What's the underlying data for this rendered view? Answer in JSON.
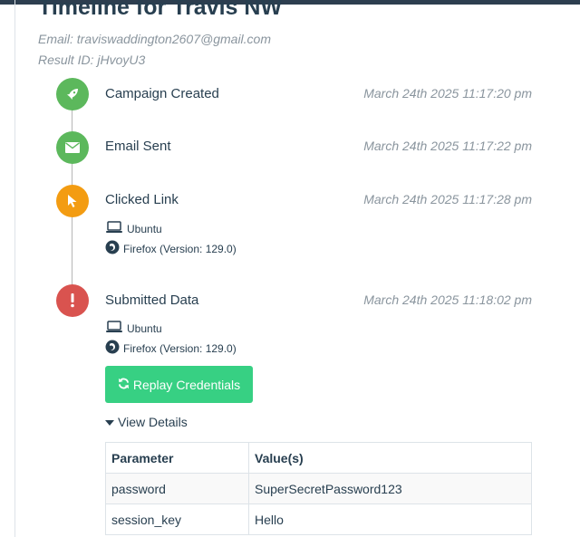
{
  "header": {
    "title": "Timeline for Travis NW",
    "email": "Email: traviswaddington2607@gmail.com",
    "result_id": "Result ID: jHvoyU3"
  },
  "events": [
    {
      "label": "Campaign Created",
      "time": "March 24th 2025 11:17:20 pm",
      "icon": "rocket-icon",
      "color": "#5cb85c"
    },
    {
      "label": "Email Sent",
      "time": "March 24th 2025 11:17:22 pm",
      "icon": "envelope-icon",
      "color": "#5cb85c"
    },
    {
      "label": "Clicked Link",
      "time": "March 24th 2025 11:17:28 pm",
      "icon": "cursor-icon",
      "color": "#f39c12",
      "os": "Ubuntu",
      "browser": "Firefox (Version: 129.0)"
    },
    {
      "label": "Submitted Data",
      "time": "March 24th 2025 11:18:02 pm",
      "icon": "exclamation-icon",
      "color": "#d9534f",
      "os": "Ubuntu",
      "browser": "Firefox (Version: 129.0)"
    }
  ],
  "replay_button": "Replay Credentials",
  "view_details": "View Details",
  "details_table": {
    "headers": [
      "Parameter",
      "Value(s)"
    ],
    "rows": [
      [
        "password",
        "SuperSecretPassword123"
      ],
      [
        "session_key",
        "Hello"
      ]
    ]
  }
}
